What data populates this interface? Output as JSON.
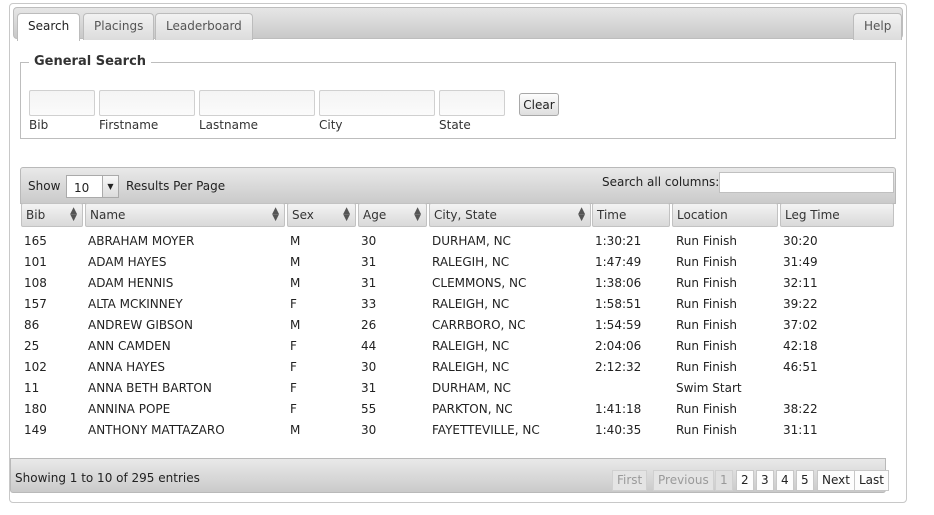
{
  "tabs": [
    {
      "label": "Search",
      "active": true
    },
    {
      "label": "Placings",
      "active": false
    },
    {
      "label": "Leaderboard",
      "active": false
    }
  ],
  "help_label": "Help",
  "general_search": {
    "legend": "General Search",
    "fields": [
      {
        "label": "Bib",
        "value": ""
      },
      {
        "label": "Firstname",
        "value": ""
      },
      {
        "label": "Lastname",
        "value": ""
      },
      {
        "label": "City",
        "value": ""
      },
      {
        "label": "State",
        "value": ""
      }
    ],
    "clear_label": "Clear"
  },
  "table_tools": {
    "show_label": "Show",
    "page_length": "10",
    "per_page_label": "Results Per Page",
    "search_label": "Search all columns:",
    "search_value": ""
  },
  "columns": [
    "Bib",
    "Name",
    "Sex",
    "Age",
    "City, State",
    "Time",
    "Location",
    "Leg Time"
  ],
  "rows": [
    [
      "165",
      "ABRAHAM MOYER",
      "M",
      "30",
      "DURHAM, NC",
      "1:30:21",
      "Run Finish",
      "30:20"
    ],
    [
      "101",
      "ADAM HAYES",
      "M",
      "31",
      "RALEGIH, NC",
      "1:47:49",
      "Run Finish",
      "31:49"
    ],
    [
      "108",
      "ADAM HENNIS",
      "M",
      "31",
      "CLEMMONS, NC",
      "1:38:06",
      "Run Finish",
      "32:11"
    ],
    [
      "157",
      "ALTA MCKINNEY",
      "F",
      "33",
      "RALEIGH, NC",
      "1:58:51",
      "Run Finish",
      "39:22"
    ],
    [
      "86",
      "ANDREW GIBSON",
      "M",
      "26",
      "CARRBORO, NC",
      "1:54:59",
      "Run Finish",
      "37:02"
    ],
    [
      "25",
      "ANN CAMDEN",
      "F",
      "44",
      "RALEIGH, NC",
      "2:04:06",
      "Run Finish",
      "42:18"
    ],
    [
      "102",
      "ANNA HAYES",
      "F",
      "30",
      "RALEIGH, NC",
      "2:12:32",
      "Run Finish",
      "46:51"
    ],
    [
      "11",
      "ANNA BETH BARTON",
      "F",
      "31",
      "DURHAM, NC",
      "",
      "Swim Start",
      ""
    ],
    [
      "180",
      "ANNINA POPE",
      "F",
      "55",
      "PARKTON, NC",
      "1:41:18",
      "Run Finish",
      "38:22"
    ],
    [
      "149",
      "ANTHONY MATTAZARO",
      "M",
      "30",
      "FAYETTEVILLE, NC",
      "1:40:35",
      "Run Finish",
      "31:11"
    ]
  ],
  "footer": {
    "info": "Showing 1 to 10 of 295 entries",
    "first": "First",
    "previous": "Previous",
    "pages": [
      "1",
      "2",
      "3",
      "4",
      "5"
    ],
    "current_page": "1",
    "next": "Next",
    "last": "Last"
  }
}
